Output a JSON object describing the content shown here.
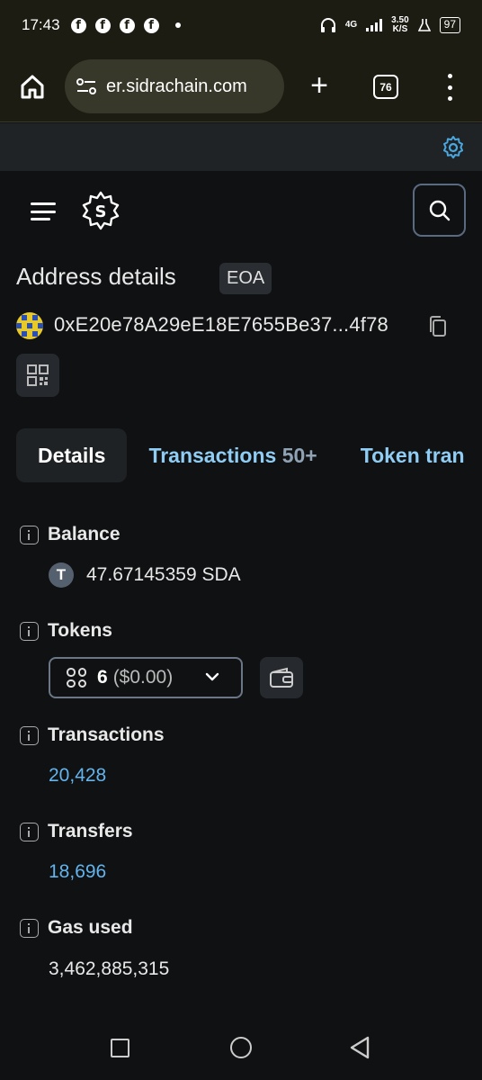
{
  "status_bar": {
    "time": "17:43",
    "network": "4G",
    "speed_value": "3.50",
    "speed_unit": "K/S",
    "battery": "97",
    "notification_icons": [
      "facebook-icon",
      "facebook-icon",
      "facebook-icon",
      "facebook-icon"
    ]
  },
  "browser": {
    "url": "er.sidrachain.com",
    "tab_count": "76"
  },
  "page": {
    "title": "Address details",
    "badge": "EOA",
    "address": "0xE20e78A29eE18E7655Be37...4f78"
  },
  "tabs": [
    {
      "label": "Details",
      "count": ""
    },
    {
      "label": "Transactions",
      "count": "50+"
    },
    {
      "label": "Token tran",
      "count": ""
    }
  ],
  "details": {
    "balance": {
      "label": "Balance",
      "token_symbol_letter": "T",
      "value": "47.67145359 SDA"
    },
    "tokens": {
      "label": "Tokens",
      "count": "6",
      "usd": "($0.00)"
    },
    "transactions": {
      "label": "Transactions",
      "value": "20,428"
    },
    "transfers": {
      "label": "Transfers",
      "value": "18,696"
    },
    "gas_used": {
      "label": "Gas used",
      "value": "3,462,885,315"
    }
  },
  "colors": {
    "background": "#101112",
    "link": "#63b3ed",
    "tab_link": "#90cdf4",
    "chrome": "#1c1c12",
    "gear": "#4aa8e0"
  }
}
